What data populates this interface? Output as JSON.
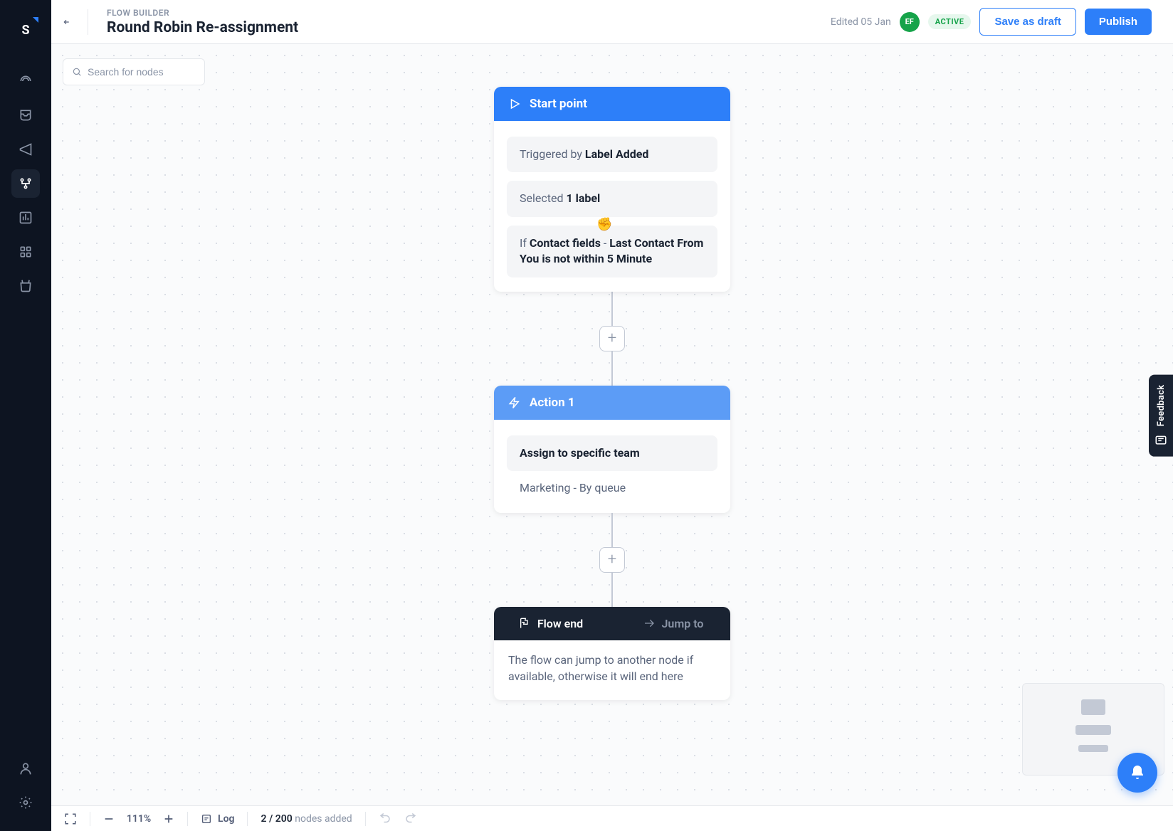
{
  "header": {
    "subtitle": "FLOW BUILDER",
    "title": "Round Robin Re-assignment",
    "edited_text": "Edited 05 Jan",
    "avatar_initials": "EF",
    "status": "ACTIVE",
    "save_draft_label": "Save as draft",
    "publish_label": "Publish"
  },
  "search": {
    "placeholder": "Search for nodes"
  },
  "start_node": {
    "title": "Start point",
    "trigger_prefix": "Triggered by ",
    "trigger_bold": "Label Added",
    "selected_prefix": "Selected ",
    "selected_bold": "1 label",
    "condition_if": "If ",
    "condition_bold1": "Contact fields",
    "condition_dash": " - ",
    "condition_bold2": "Last Contact From You is not within 5 Minute"
  },
  "action_node": {
    "title": "Action 1",
    "action_label": "Assign to specific team",
    "detail": "Marketing - By queue"
  },
  "end_node": {
    "tab1": "Flow end",
    "tab2": "Jump to",
    "body": "The flow can jump to another node if available, otherwise it will end here"
  },
  "bottom": {
    "zoom": "111%",
    "log_label": "Log",
    "nodes_bold": "2 / 200",
    "nodes_text": " nodes added"
  },
  "feedback": {
    "label": "Feedback"
  }
}
